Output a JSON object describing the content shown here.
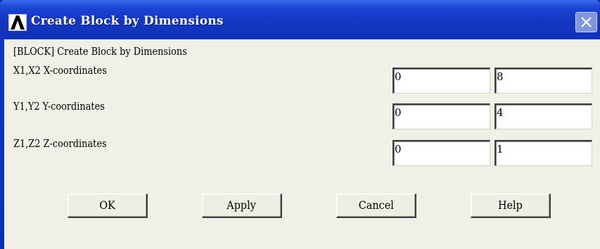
{
  "window": {
    "title": "Create Block by Dimensions",
    "app_icon": "ansys-logo-icon",
    "close_icon": "close-icon"
  },
  "dialog": {
    "command_label": "[BLOCK]  Create Block by Dimensions",
    "rows": [
      {
        "label": "X1,X2  X-coordinates",
        "value1": "0",
        "value2": "8"
      },
      {
        "label": "Y1,Y2  Y-coordinates",
        "value1": "0",
        "value2": "4"
      },
      {
        "label": "Z1,Z2  Z-coordinates",
        "value1": "0",
        "value2": "1"
      }
    ],
    "buttons": {
      "ok": "OK",
      "apply": "Apply",
      "cancel": "Cancel",
      "help": "Help"
    }
  },
  "colors": {
    "titlebar": "#1438c4",
    "client_background": "#f0f0e6",
    "field_background": "#ffffff"
  }
}
